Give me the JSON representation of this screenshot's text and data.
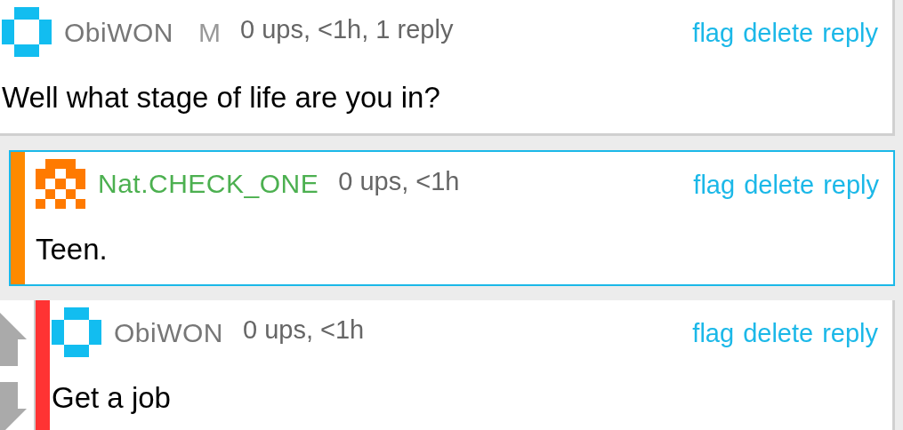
{
  "comments": [
    {
      "user": {
        "name": "ObiWON",
        "color": "#777777"
      },
      "avatar": {
        "kind": "ring",
        "color": "#12bdf0"
      },
      "badge": "M",
      "meta": "0 ups, <1h, 1 reply",
      "actions": [
        "flag",
        "delete",
        "reply"
      ],
      "body": "Well what stage of life are you in?",
      "highlighted": false
    },
    {
      "user": {
        "name": "Nat.CHECK_ONE",
        "color": "#4cb050"
      },
      "avatar": {
        "kind": "invader",
        "color": "#ff7a00"
      },
      "meta": "0 ups, <1h",
      "actions": [
        "flag",
        "delete",
        "reply"
      ],
      "body": "Teen.",
      "highlighted": true,
      "color": "#ff8a00"
    },
    {
      "user": {
        "name": "ObiWON",
        "color": "#777777"
      },
      "avatar": {
        "kind": "ring",
        "color": "#12bdf0"
      },
      "meta": "0 ups, <1h",
      "actions": [
        "flag",
        "delete",
        "reply"
      ],
      "body": "Get a job",
      "highlighted": false,
      "color": "#ff3333",
      "vote_arrows": true
    }
  ]
}
